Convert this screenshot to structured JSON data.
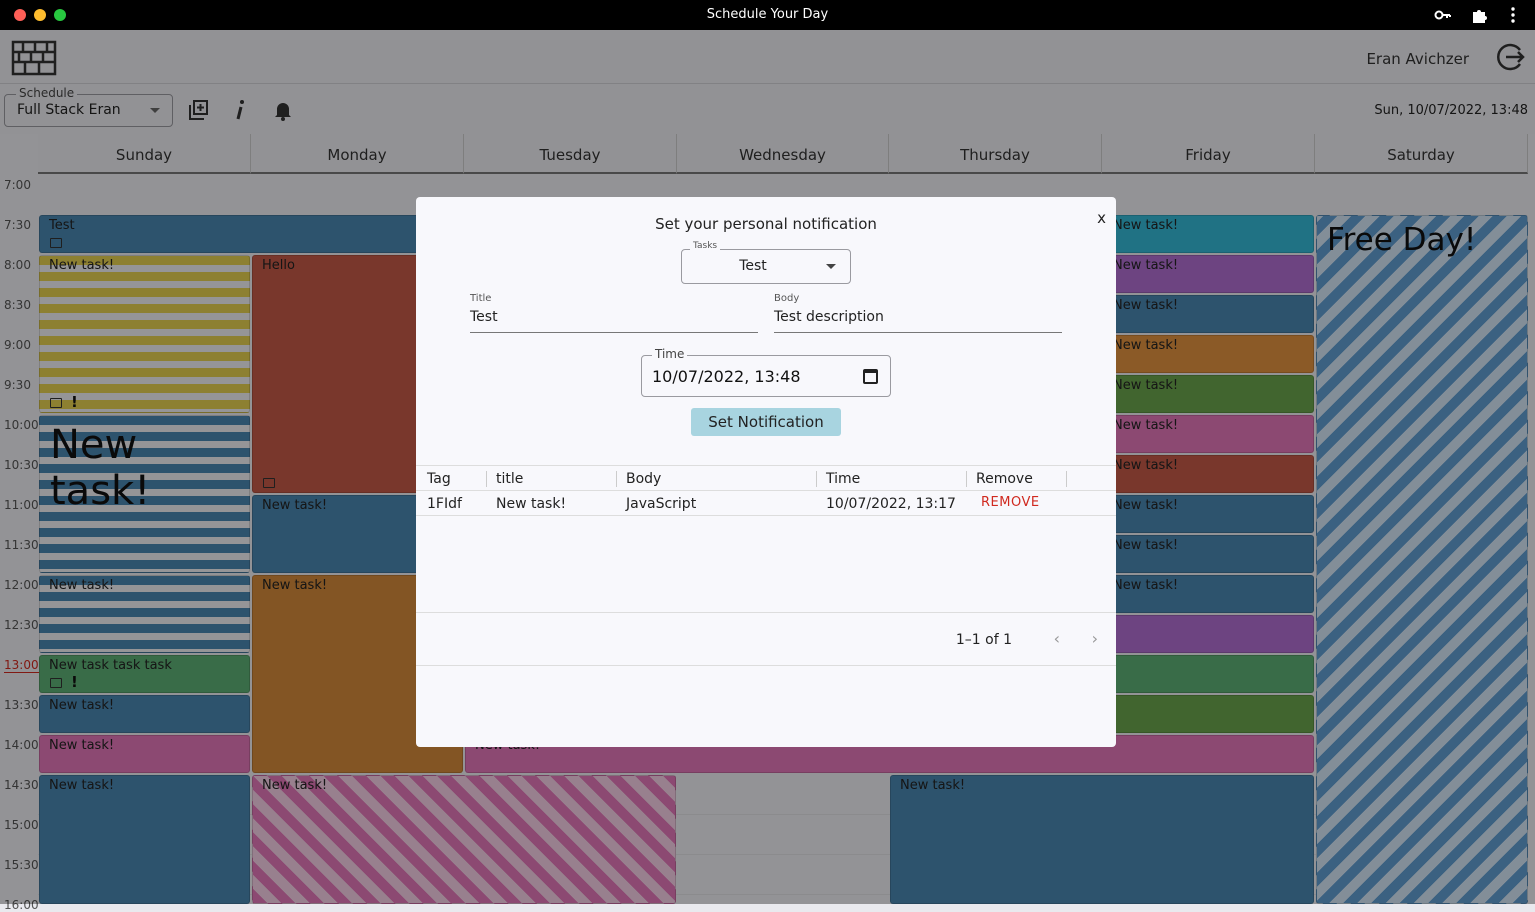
{
  "window": {
    "title": "Schedule Your Day"
  },
  "header": {
    "user_name": "Eran Avichzer"
  },
  "toolbar": {
    "schedule_label": "Schedule",
    "schedule_value": "Full Stack Eran",
    "datetime": "Sun, 10/07/2022, 13:48"
  },
  "calendar": {
    "days": [
      "Sunday",
      "Monday",
      "Tuesday",
      "Wednesday",
      "Thursday",
      "Friday",
      "Saturday"
    ],
    "hours": [
      "7:00",
      "7:30",
      "8:00",
      "8:30",
      "9:00",
      "9:30",
      "10:00",
      "10:30",
      "11:00",
      "11:30",
      "12:00",
      "12:30",
      "13:00",
      "13:30",
      "14:00",
      "14:30",
      "15:00",
      "15:30",
      "16:00"
    ],
    "current_hour": "13:00",
    "tasks": {
      "sun_test": "Test",
      "sun_new1": "New task!",
      "sun_big": "New task!",
      "sun_new2": "New task!",
      "sun_green": "New task task task",
      "sun_new3": "New task!",
      "sun_new4": "New task!",
      "sun_new5": "New task!",
      "mon_hello": "Hello",
      "mon_new1": "New task!",
      "mon_new2": "New task!",
      "mon_new3": "New task!",
      "fri_new": "New task!",
      "thu_new": "New task!",
      "tue_new": "New task!",
      "sat_free": "Free Day!"
    }
  },
  "modal": {
    "title": "Set your personal notification",
    "close_label": "x",
    "tasks_label": "Tasks",
    "tasks_value": "Test",
    "title_label": "Title",
    "title_value": "Test",
    "body_label": "Body",
    "body_value": "Test description",
    "time_label": "Time",
    "time_value": "10/07/2022, 13:48",
    "submit_label": "Set Notification",
    "table": {
      "headers": [
        "Tag",
        "title",
        "Body",
        "Time",
        "Remove"
      ],
      "rows": [
        {
          "tag": "1FIdf",
          "title": "New task!",
          "body": "JavaScript",
          "time": "10/07/2022, 13:17",
          "remove": "REMOVE"
        }
      ]
    },
    "pagination": "1–1 of 1"
  }
}
